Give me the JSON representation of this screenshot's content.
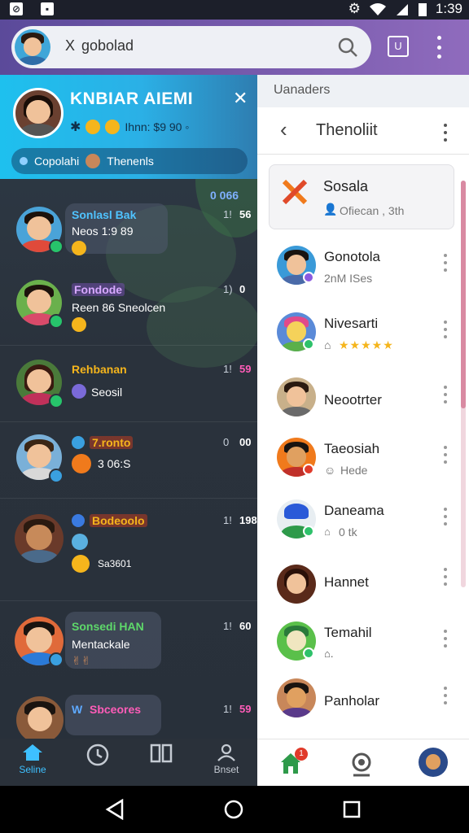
{
  "status_bar": {
    "left_icons": [
      "notification-icon",
      "image-icon"
    ],
    "right_icons": [
      "alarm-icon",
      "wifi-icon",
      "signal-icon",
      "battery-icon"
    ],
    "time": "1:39"
  },
  "top_bar": {
    "search_prefix": "X",
    "search_text": "gobolad",
    "colors": {
      "start": "#5b4a9a",
      "end": "#8f6bbd"
    },
    "app_button_label": "U"
  },
  "left_panel": {
    "banner": {
      "title": "KNBIAR AIEMI",
      "subtitle": "Ihnn: $9 90 ◦",
      "pill_text_1": "Copolahi",
      "pill_text_2": "Thenenls"
    },
    "chats": [
      {
        "name": "Sonlasl Bak",
        "message": "Neos 1:9 89",
        "time": "1!",
        "count": "56"
      },
      {
        "name": "Fondode",
        "message": "Reen 86 Sneolcen",
        "time": "1)",
        "count": "0"
      },
      {
        "name": "Rehbanan",
        "message": "Seosil",
        "time": "1!",
        "count": "59"
      },
      {
        "name": "7.ronto",
        "message": "3 06:S",
        "time": "0",
        "count": "00"
      },
      {
        "name": "Bodeoolo",
        "message": "Sa3601",
        "time": "1!",
        "count": "198"
      },
      {
        "name": "Sonsedi HAN",
        "message": "Mentackale",
        "time": "1!",
        "count": "60"
      },
      {
        "name": "Sbceores",
        "message": "",
        "time": "1!",
        "count": "59"
      }
    ],
    "top_right_counter": "0 066",
    "bottom_nav": [
      {
        "label": "Seline",
        "icon": "home-icon"
      },
      {
        "label": "",
        "icon": "clock-icon"
      },
      {
        "label": "",
        "icon": "grid-icon"
      },
      {
        "label": "Bnset",
        "icon": "profile-icon"
      }
    ]
  },
  "right_panel": {
    "header": "Uanaders",
    "title": "Thenoliit",
    "card": {
      "name": "Sosala",
      "sub": "Ofiecan , 3th"
    },
    "contacts": [
      {
        "name": "Gonotola",
        "sub": "2nM ISes"
      },
      {
        "name": "Nivesarti",
        "sub": "★★★★★"
      },
      {
        "name": "Neootrter",
        "sub": ""
      },
      {
        "name": "Taeosiah",
        "sub": "Hede"
      },
      {
        "name": "Daneama",
        "sub": "0 tk"
      },
      {
        "name": "Hannet",
        "sub": ""
      },
      {
        "name": "Temahil",
        "sub": ""
      },
      {
        "name": "Panholar",
        "sub": ""
      }
    ],
    "bottom_notif_count": "1"
  },
  "system_nav": [
    "back-icon",
    "home-circle-icon",
    "recents-icon"
  ]
}
